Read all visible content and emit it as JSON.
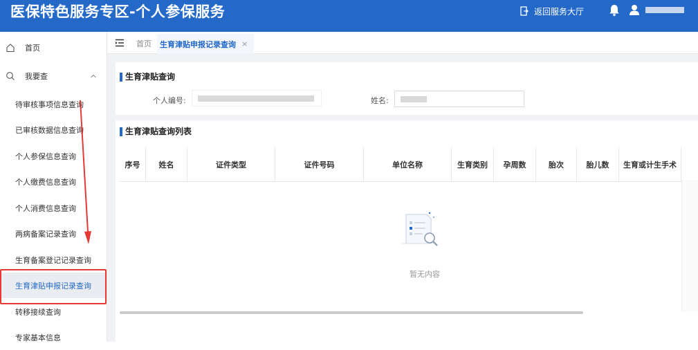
{
  "header": {
    "title": "医保特色服务专区-个人参保服务",
    "return_label": "返回服务大厅"
  },
  "sidebar": {
    "home_label": "首页",
    "group_label": "我要查",
    "items": [
      {
        "label": "待审核事项信息查询"
      },
      {
        "label": "已审核数据信息查询"
      },
      {
        "label": "个人参保信息查询"
      },
      {
        "label": "个人缴费信息查询"
      },
      {
        "label": "个人消费信息查询"
      },
      {
        "label": "两病备案记录查询"
      },
      {
        "label": "生育备案登记记录查询"
      },
      {
        "label": "生育津贴申报记录查询",
        "active": true
      },
      {
        "label": "转移接续查询"
      },
      {
        "label": "专家基本信息"
      }
    ]
  },
  "tabs": {
    "home": "首页",
    "active": "生育津贴申报记录查询",
    "close": "×"
  },
  "search": {
    "title": "生育津贴查询",
    "person_id_label": "个人编号:",
    "name_label": "姓名:"
  },
  "list": {
    "title": "生育津贴查询列表",
    "columns": [
      "序号",
      "姓名",
      "证件类型",
      "证件号码",
      "单位名称",
      "生育类别",
      "孕周数",
      "胎次",
      "胎儿数",
      "生育或计生手术"
    ],
    "empty_text": "暂无内容"
  },
  "colors": {
    "brand": "#2469c8",
    "annotation": "#e53935"
  }
}
